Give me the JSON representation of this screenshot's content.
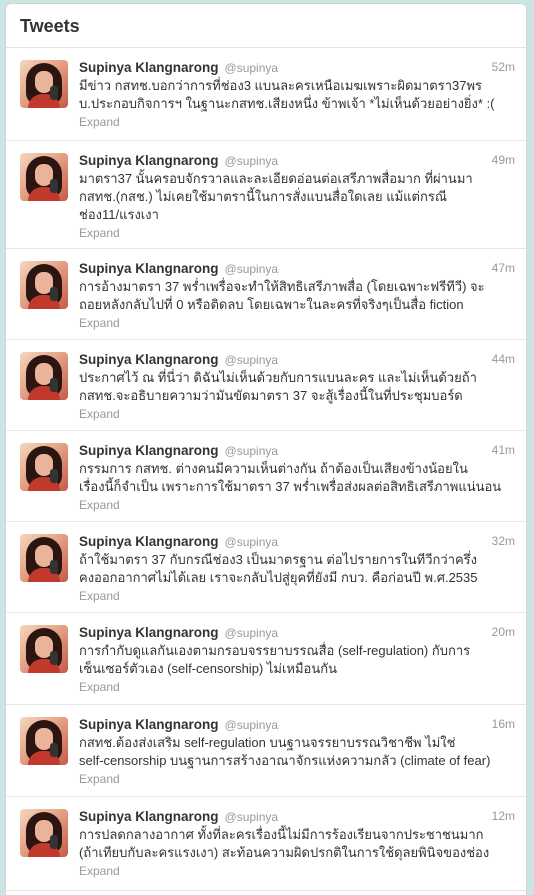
{
  "header": {
    "title": "Tweets"
  },
  "expand_label": "Expand",
  "tweets": [
    {
      "name": "Supinya Klangnarong",
      "handle": "@supinya",
      "time": "52m",
      "lines": [
        "มีข่าว กสทช.บอกว่าการที่ช่อง3 แบนละครเหนือเมฆเพราะผิดมาตรา37พร",
        "บ.ประกอบกิจการฯ ในฐานะกสทช.เสียงหนึ่ง ข้าพเจ้า *ไม่เห็นด้วยอย่างยิ่ง* :("
      ]
    },
    {
      "name": "Supinya Klangnarong",
      "handle": "@supinya",
      "time": "49m",
      "lines": [
        "มาตรา37 นั้นครอบจักรวาลและละเอียดอ่อนต่อเสรีภาพสื่อมาก ที่ผ่านมา",
        "กสทช.(กสช.) ไม่เคยใช้มาตรานี้ในการสั่งแบนสื่อใดเลย แม้แต่กรณี",
        "ช่อง11/แรงเงา"
      ]
    },
    {
      "name": "Supinya Klangnarong",
      "handle": "@supinya",
      "time": "47m",
      "lines": [
        "การอ้างมาตรา 37 พร่ำเพรื่อจะทำให้สิทธิเสรีภาพสื่อ (โดยเฉพาะฟรีทีวี) จะ",
        "ถอยหลังกลับไปที่ 0 หรือติดลบ โดยเฉพาะในละครที่จริงๆเป็นสื่อ fiction"
      ]
    },
    {
      "name": "Supinya Klangnarong",
      "handle": "@supinya",
      "time": "44m",
      "lines": [
        "ประกาศไว้ ณ ที่นี่ว่า ดิฉันไม่เห็นด้วยกับการแบนละคร และไม่เห็นด้วยถ้า",
        "กสทช.จะอธิบายความว่ามันขัดมาตรา 37 จะสู้เรื่องนี้ในที่ประชุมบอร์ด"
      ]
    },
    {
      "name": "Supinya Klangnarong",
      "handle": "@supinya",
      "time": "41m",
      "lines": [
        "กรรมการ กสทช. ต่างคนมีความเห็นต่างกัน ถ้าต้องเป็นเสียงข้างน้อยใน",
        "เรื่องนี้ก็จำเป็น เพราะการใช้มาตรา 37 พร่ำเพรื่อส่งผลต่อสิทธิเสรีภาพแน่นอน"
      ]
    },
    {
      "name": "Supinya Klangnarong",
      "handle": "@supinya",
      "time": "32m",
      "lines": [
        "ถ้าใช้มาตรา 37 กับกรณีช่อง3 เป็นมาตรฐาน ต่อไปรายการในทีวีกว่าครึ่ง",
        "คงออกอากาศไม่ได้เลย เราจะกลับไปสู่ยุคที่ยังมี กบว. คือก่อนปี พ.ศ.2535"
      ]
    },
    {
      "name": "Supinya Klangnarong",
      "handle": "@supinya",
      "time": "20m",
      "lines": [
        "การกำกับดูแลกันเองตามกรอบจรรยาบรรณสื่อ (self-regulation) กับการ",
        "เซ็นเซอร์ตัวเอง (self-censorship) ไม่เหมือนกัน"
      ]
    },
    {
      "name": "Supinya Klangnarong",
      "handle": "@supinya",
      "time": "16m",
      "lines": [
        "กสทช.ต้องส่งเสริม self-regulation บนฐานจรรยาบรรณวิชาชีพ ไม่ใช่",
        "self-censorship บนฐานการสร้างอาณาจักรแห่งความกลัว (climate of fear)"
      ]
    },
    {
      "name": "Supinya Klangnarong",
      "handle": "@supinya",
      "time": "12m",
      "lines": [
        "การปลดกลางอากาศ ทั้งที่ละครเรื่องนี้ไม่มีการร้องเรียนจากประชาชนมาก",
        "(ถ้าเทียบกับละครแรงเงา) สะท้อนความผิดปรกติในการใช้ดุลยพินิจของช่อง"
      ]
    }
  ]
}
